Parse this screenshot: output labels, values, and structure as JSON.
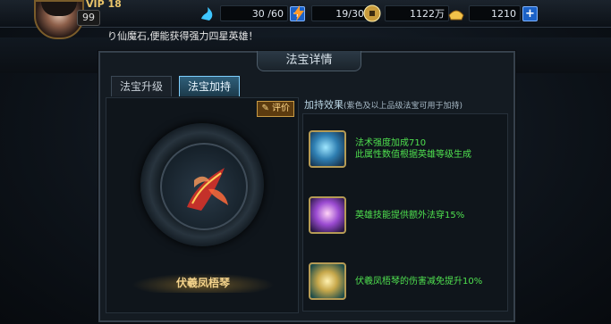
{
  "topbar": {
    "vip": "VIP 18",
    "level": "99",
    "stamina": {
      "value": "30 /60",
      "plus": "+"
    },
    "energy": {
      "value": "19/30"
    },
    "coins": {
      "value": "1122万"
    },
    "ingots": {
      "value": "1210",
      "plus": "+"
    }
  },
  "marquee": "り仙魔石,便能获得强力四星英雄！",
  "panel": {
    "title": "法宝详情",
    "tabs": [
      {
        "label": "法宝升级",
        "active": false
      },
      {
        "label": "法宝加持",
        "active": true
      }
    ],
    "review_label": "评价",
    "item_name": "伏羲凤梧琴",
    "effects_header": "加持效果",
    "effects_note": "(紫色及以上品级法宝可用于加持)",
    "effects": [
      {
        "icon": "blue-gem-icon",
        "line1": "法术强度加成710",
        "line2": "此属性数值根据英雄等级生成"
      },
      {
        "icon": "purple-robe-icon",
        "line1": "英雄技能提供额外法穿15%",
        "line2": ""
      },
      {
        "icon": "golden-sword-icon",
        "line1": "伏羲凤梧琴的伤害减免提升10%",
        "line2": ""
      }
    ]
  },
  "colors": {
    "accent_tab": "#7fd0ff",
    "effect_text": "#4fe04f",
    "gold": "#f4d38b"
  }
}
